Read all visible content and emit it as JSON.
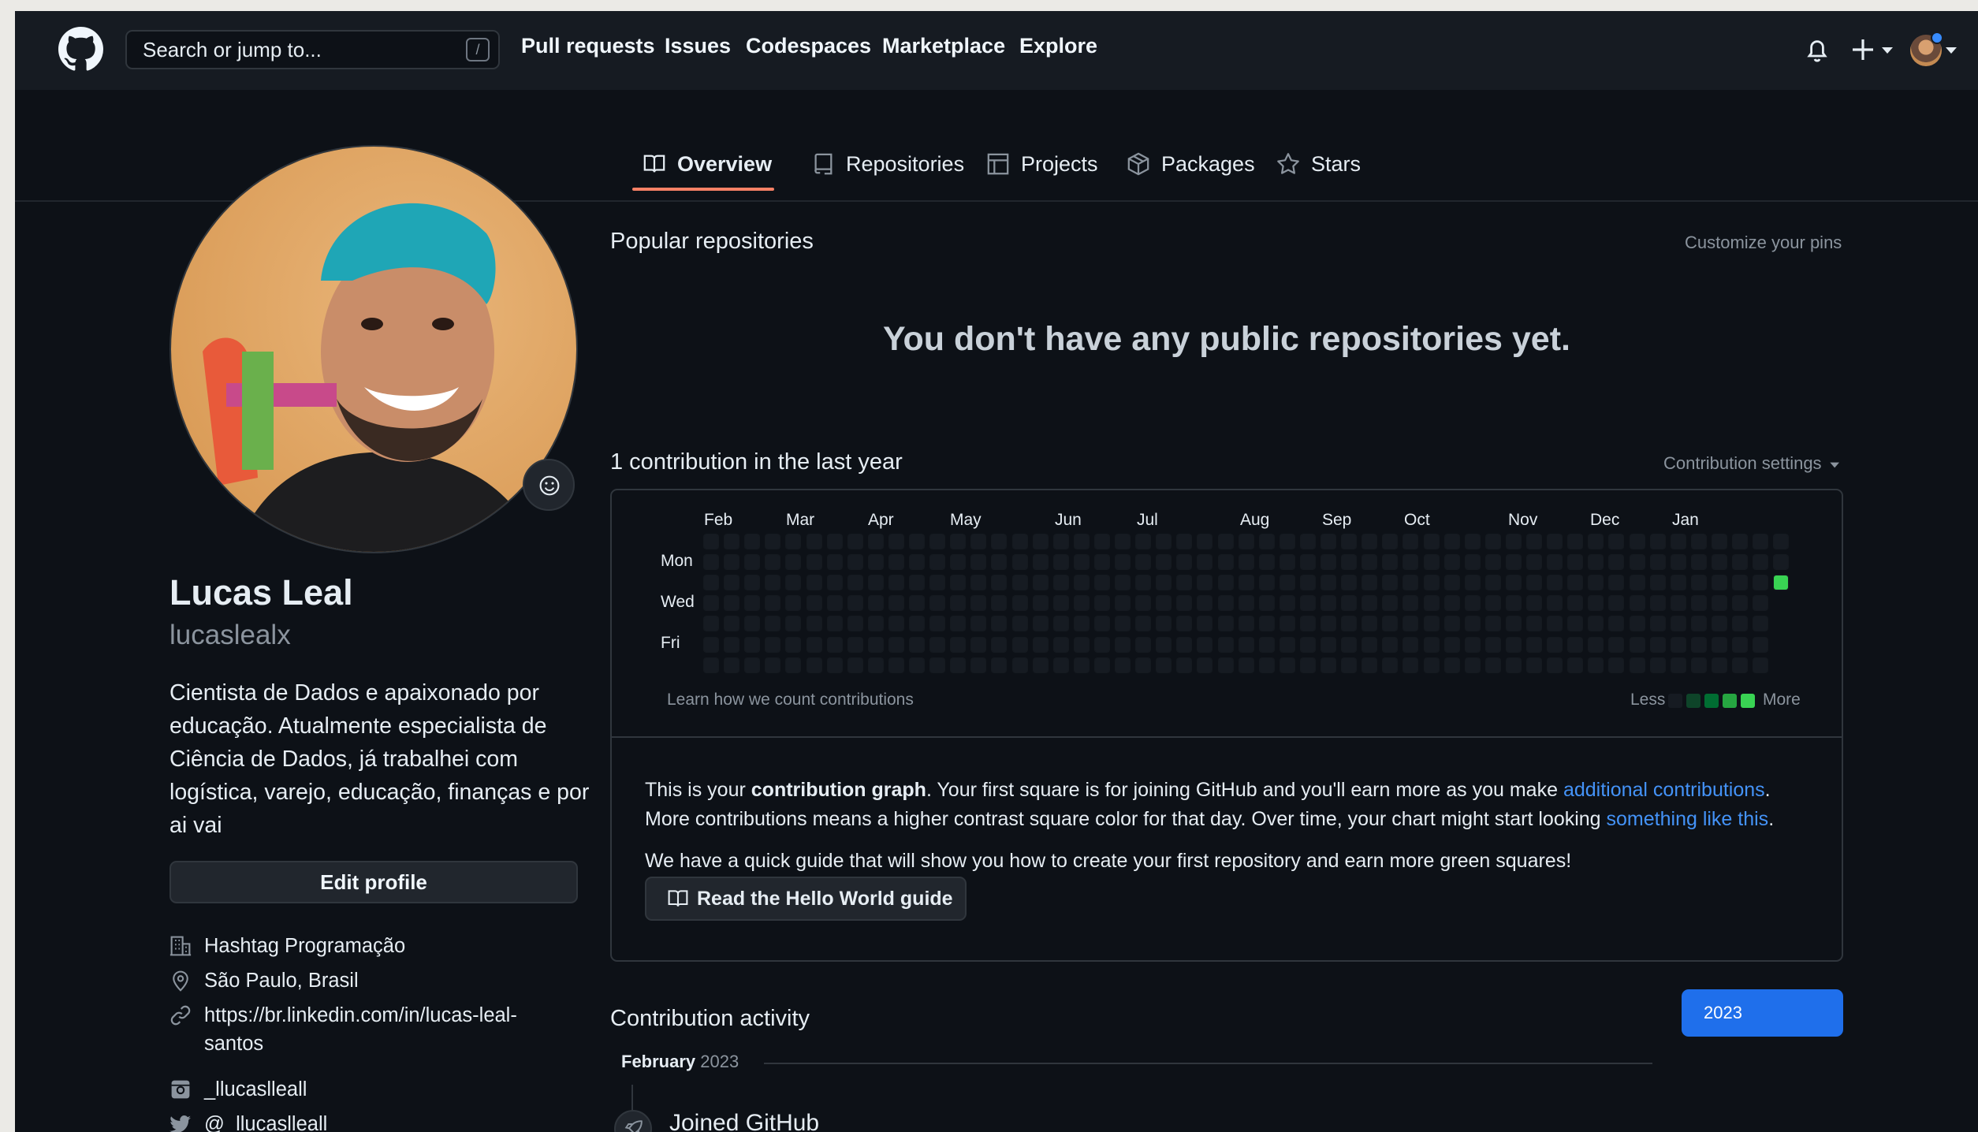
{
  "header": {
    "search_placeholder": "Search or jump to...",
    "search_shortcut": "/",
    "nav": [
      "Pull requests",
      "Issues",
      "Codespaces",
      "Marketplace",
      "Explore"
    ]
  },
  "tabs": [
    "Overview",
    "Repositories",
    "Projects",
    "Packages",
    "Stars"
  ],
  "profile": {
    "name": "Lucas Leal",
    "username": "lucaslealx",
    "bio": "Cientista de Dados e apaixonado por educação. Atualmente especialista de Ciência de Dados, já trabalhei com logística, varejo, educação, finanças e por ai vai",
    "edit_label": "Edit profile",
    "company": "Hashtag Programação",
    "location": "São Paulo, Brasil",
    "website_line1": "https://br.linkedin.com/in/lucas-leal-",
    "website_line2": "santos",
    "instagram": "_llucaslleall",
    "twitter": "@_llucaslleall"
  },
  "popular": {
    "title": "Popular repositories",
    "customize": "Customize your pins",
    "empty": "You don't have any public repositories yet."
  },
  "contributions": {
    "title": "1 contribution in the last year",
    "settings": "Contribution settings",
    "months": [
      "Feb",
      "Mar",
      "Apr",
      "May",
      "Jun",
      "Jul",
      "Aug",
      "Sep",
      "Oct",
      "Nov",
      "Dec",
      "Jan"
    ],
    "days": [
      "Mon",
      "Wed",
      "Fri"
    ],
    "learn": "Learn how we count contributions",
    "less": "Less",
    "more": "More",
    "weeks": 53,
    "total_contributions": 1,
    "contribution_day": "last week, Wednesday",
    "colors": {
      "empty": "#161b22",
      "level1": "#0e4429",
      "level2": "#006d32",
      "level3": "#26a641",
      "level4": "#39d353"
    }
  },
  "info": {
    "p1_a": "This is your ",
    "p1_b": "contribution graph",
    "p1_c": ". Your first square is for joining GitHub and you'll earn more as you make ",
    "p1_link": "additional contributions",
    "p1_d": ".",
    "p2_a": "More contributions means a higher contrast square color for that day. Over time, your chart might start looking ",
    "p2_link": "something like this",
    "p2_b": ".",
    "p3": "We have a quick guide that will show you how to create your first repository and earn more green squares!",
    "guide_btn": "Read the Hello World guide"
  },
  "activity": {
    "title": "Contribution activity",
    "year": "2023",
    "month": "February",
    "month_year": "2023",
    "event": "Joined GitHub"
  },
  "colors": {
    "accent_blue": "#1f6feb",
    "link": "#4493f8",
    "tab_underline": "#f78166",
    "notification_dot": "#388bfd"
  }
}
